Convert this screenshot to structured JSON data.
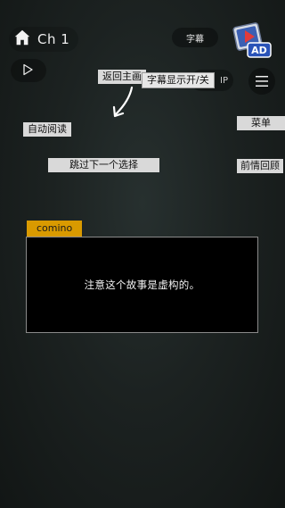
{
  "header": {
    "chapter": "Ch 1",
    "subtitle_button": "字幕",
    "skip_button": "IP"
  },
  "tooltips": {
    "return_main": "返回主画",
    "subtitle_toggle": "字幕显示开/关",
    "auto_read": "自动阅读",
    "skip_next_choice": "跳过下一个选择",
    "menu": "菜单",
    "recap": "前情回顾"
  },
  "dialogue": {
    "speaker": "comino",
    "text": "注意这个故事是虚构的。"
  },
  "logo": {
    "text": "AD"
  },
  "icons": {
    "home": "home-icon",
    "play": "play-icon",
    "menu": "menu-icon",
    "arrow": "curved-arrow-icon"
  }
}
